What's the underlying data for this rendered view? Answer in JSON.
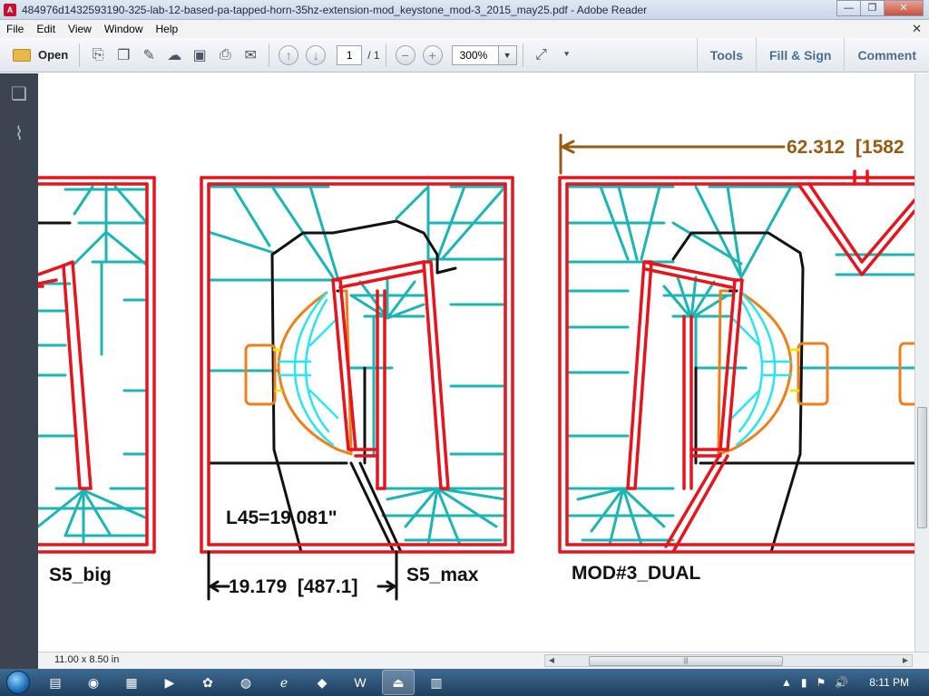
{
  "window": {
    "title": "484976d1432593190-325-lab-12-based-pa-tapped-horn-35hz-extension-mod_keystone_mod-3_2015_may25.pdf - Adobe Reader",
    "minimize": "—",
    "maximize": "❐",
    "close": "✕"
  },
  "menu": {
    "items": [
      "File",
      "Edit",
      "View",
      "Window",
      "Help"
    ],
    "close_doc": "✕"
  },
  "toolbar": {
    "open_label": "Open",
    "page_current": "1",
    "page_total": "/ 1",
    "zoom": "300%",
    "tools_label": "Tools",
    "fill_sign_label": "Fill & Sign",
    "comment_label": "Comment"
  },
  "drawing": {
    "label_s5_big": "S5_big",
    "label_s5_max": "S5_max",
    "label_mod3": "MOD#3_DUAL",
    "dim_l45": "L45=19.081\"",
    "dim_width": "19.179  [487.1]",
    "dim_top": "62.312  [1582"
  },
  "status": {
    "page_size": "11.00 x 8.50 in"
  },
  "taskbar": {
    "clock": "8:11 PM"
  },
  "colors": {
    "wall_red": "#e8131b",
    "bracing_teal": "#1bb5b5",
    "outline_black": "#111111",
    "driver_orange": "#f07f1a",
    "driver_cyan": "#29e5ef",
    "accent_yellow": "#f2e600",
    "dimension_brown": "#9a5a12"
  }
}
